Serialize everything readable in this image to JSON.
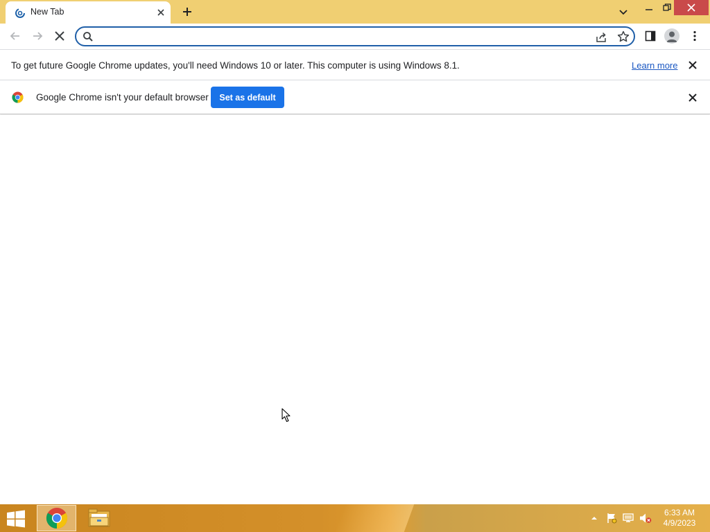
{
  "tab": {
    "title": "New Tab",
    "favicon": "loading-spinner-icon"
  },
  "window_controls": [
    "minimize-icon",
    "restore-icon",
    "close-icon"
  ],
  "omnibox": {
    "value": "",
    "placeholder": ""
  },
  "update_infobar": {
    "message": "To get future Google Chrome updates, you'll need Windows 10 or later. This computer is using Windows 8.1.",
    "link_label": "Learn more"
  },
  "default_browser_infobar": {
    "message": "Google Chrome isn't your default browser",
    "button_label": "Set as default"
  },
  "taskbar": {
    "apps": [
      "start-icon",
      "chrome-icon",
      "file-explorer-icon"
    ],
    "clock": {
      "time": "6:33 AM",
      "date": "4/9/2023"
    }
  },
  "colors": {
    "frame": "#f0cf72",
    "accent": "#1a73e8",
    "omnibox_border": "#1f5fa8",
    "close_button": "#c94a4a",
    "taskbar": "#d4902a"
  }
}
